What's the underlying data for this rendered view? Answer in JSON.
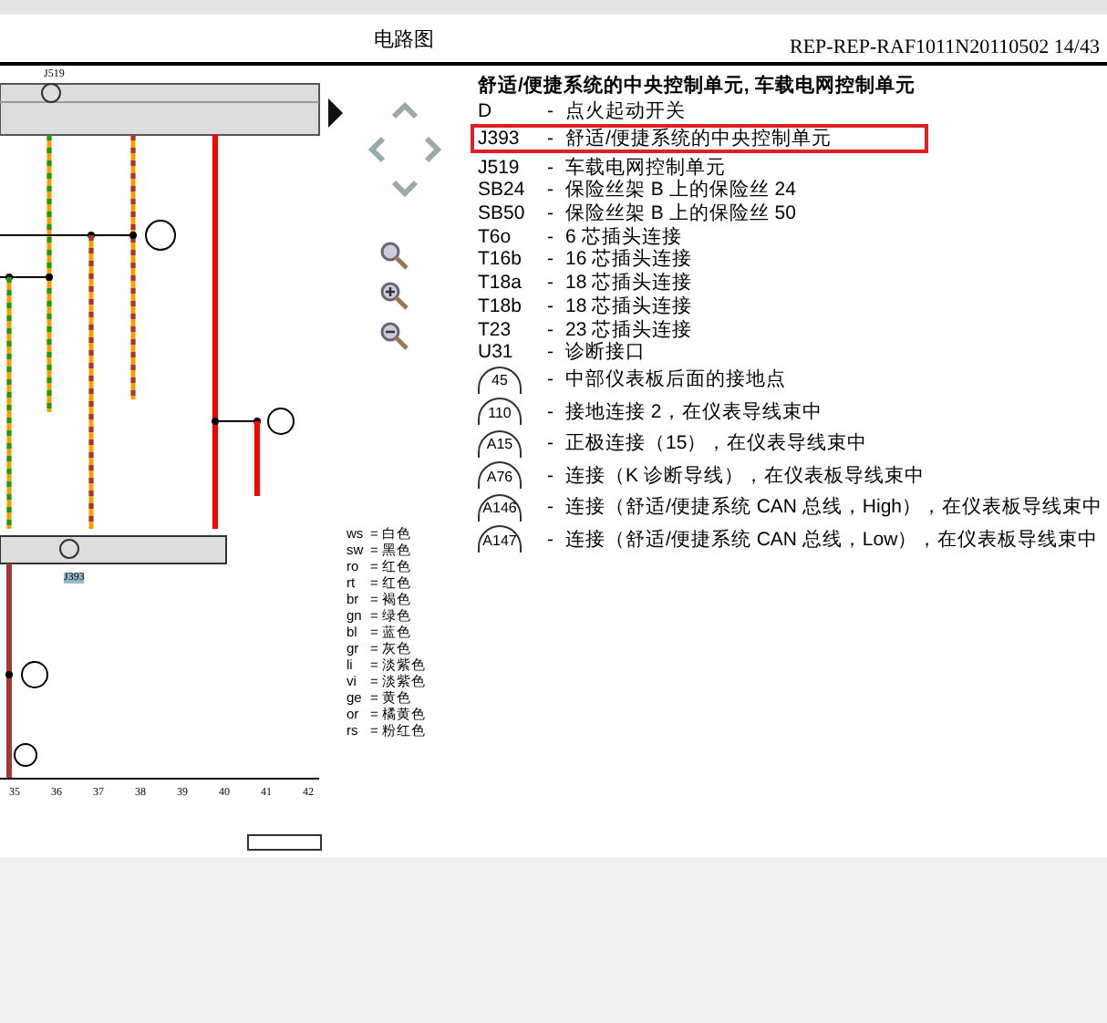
{
  "header": {
    "title": "电路图",
    "reference": "REP-REP-RAF1011N20110502 14/43"
  },
  "diagram": {
    "top_label": "J519",
    "bottom_label": "J393",
    "columns": [
      "35",
      "36",
      "37",
      "38",
      "39",
      "40",
      "41",
      "42"
    ]
  },
  "legend": {
    "title": "舒适/便捷系统的中央控制单元, 车载电网控制单元",
    "items": [
      {
        "kind": "code",
        "code": "D",
        "separator": "-",
        "text": "点火起动开关",
        "highlighted": false
      },
      {
        "kind": "code",
        "code": "J393",
        "separator": "-",
        "text": "舒适/便捷系统的中央控制单元",
        "highlighted": true
      },
      {
        "kind": "code",
        "code": "J519",
        "separator": "-",
        "text": "车载电网控制单元",
        "highlighted": false
      },
      {
        "kind": "code",
        "code": "SB24",
        "separator": "-",
        "text": "保险丝架 B 上的保险丝 24",
        "highlighted": false
      },
      {
        "kind": "code",
        "code": "SB50",
        "separator": "-",
        "text": "保险丝架 B 上的保险丝 50",
        "highlighted": false
      },
      {
        "kind": "code",
        "code": "T6o",
        "separator": "-",
        "text": "6 芯插头连接",
        "highlighted": false
      },
      {
        "kind": "code",
        "code": "T16b",
        "separator": "-",
        "text": "16 芯插头连接",
        "highlighted": false
      },
      {
        "kind": "code",
        "code": "T18a",
        "separator": "-",
        "text": "18 芯插头连接",
        "highlighted": false
      },
      {
        "kind": "code",
        "code": "T18b",
        "separator": "-",
        "text": "18 芯插头连接",
        "highlighted": false
      },
      {
        "kind": "code",
        "code": "T23",
        "separator": "-",
        "text": "23 芯插头连接",
        "highlighted": false
      },
      {
        "kind": "code",
        "code": "U31",
        "separator": "-",
        "text": "诊断接口",
        "highlighted": false
      },
      {
        "kind": "circle",
        "code": "45",
        "separator": "-",
        "text": "中部仪表板后面的接地点",
        "highlighted": false
      },
      {
        "kind": "circle",
        "code": "110",
        "separator": "-",
        "text": "接地连接 2，在仪表导线束中",
        "highlighted": false
      },
      {
        "kind": "circle",
        "code": "A15",
        "separator": "-",
        "text": "正极连接（15），在仪表导线束中",
        "highlighted": false
      },
      {
        "kind": "circle",
        "code": "A76",
        "separator": "-",
        "text": "连接（K 诊断导线），在仪表板导线束中",
        "highlighted": false
      },
      {
        "kind": "circle",
        "code": "A146",
        "separator": "-",
        "text": "连接（舒适/便捷系统 CAN 总线，High），在仪表板导线束中",
        "highlighted": false
      },
      {
        "kind": "circle",
        "code": "A147",
        "separator": "-",
        "text": "连接（舒适/便捷系统 CAN 总线，Low），在仪表板导线束中",
        "highlighted": false
      }
    ]
  },
  "colour_codes": [
    {
      "code": "ws",
      "meaning": "= 白色"
    },
    {
      "code": "sw",
      "meaning": "= 黑色"
    },
    {
      "code": "ro",
      "meaning": "= 红色"
    },
    {
      "code": "rt",
      "meaning": "= 红色"
    },
    {
      "code": "br",
      "meaning": "= 褐色"
    },
    {
      "code": "gn",
      "meaning": "= 绿色"
    },
    {
      "code": "bl",
      "meaning": "= 蓝色"
    },
    {
      "code": "gr",
      "meaning": "= 灰色"
    },
    {
      "code": "li",
      "meaning": "= 淡紫色"
    },
    {
      "code": "vi",
      "meaning": "= 淡紫色"
    },
    {
      "code": "ge",
      "meaning": "= 黄色"
    },
    {
      "code": "or",
      "meaning": "= 橘黄色"
    },
    {
      "code": "rs",
      "meaning": "= 粉红色"
    }
  ]
}
